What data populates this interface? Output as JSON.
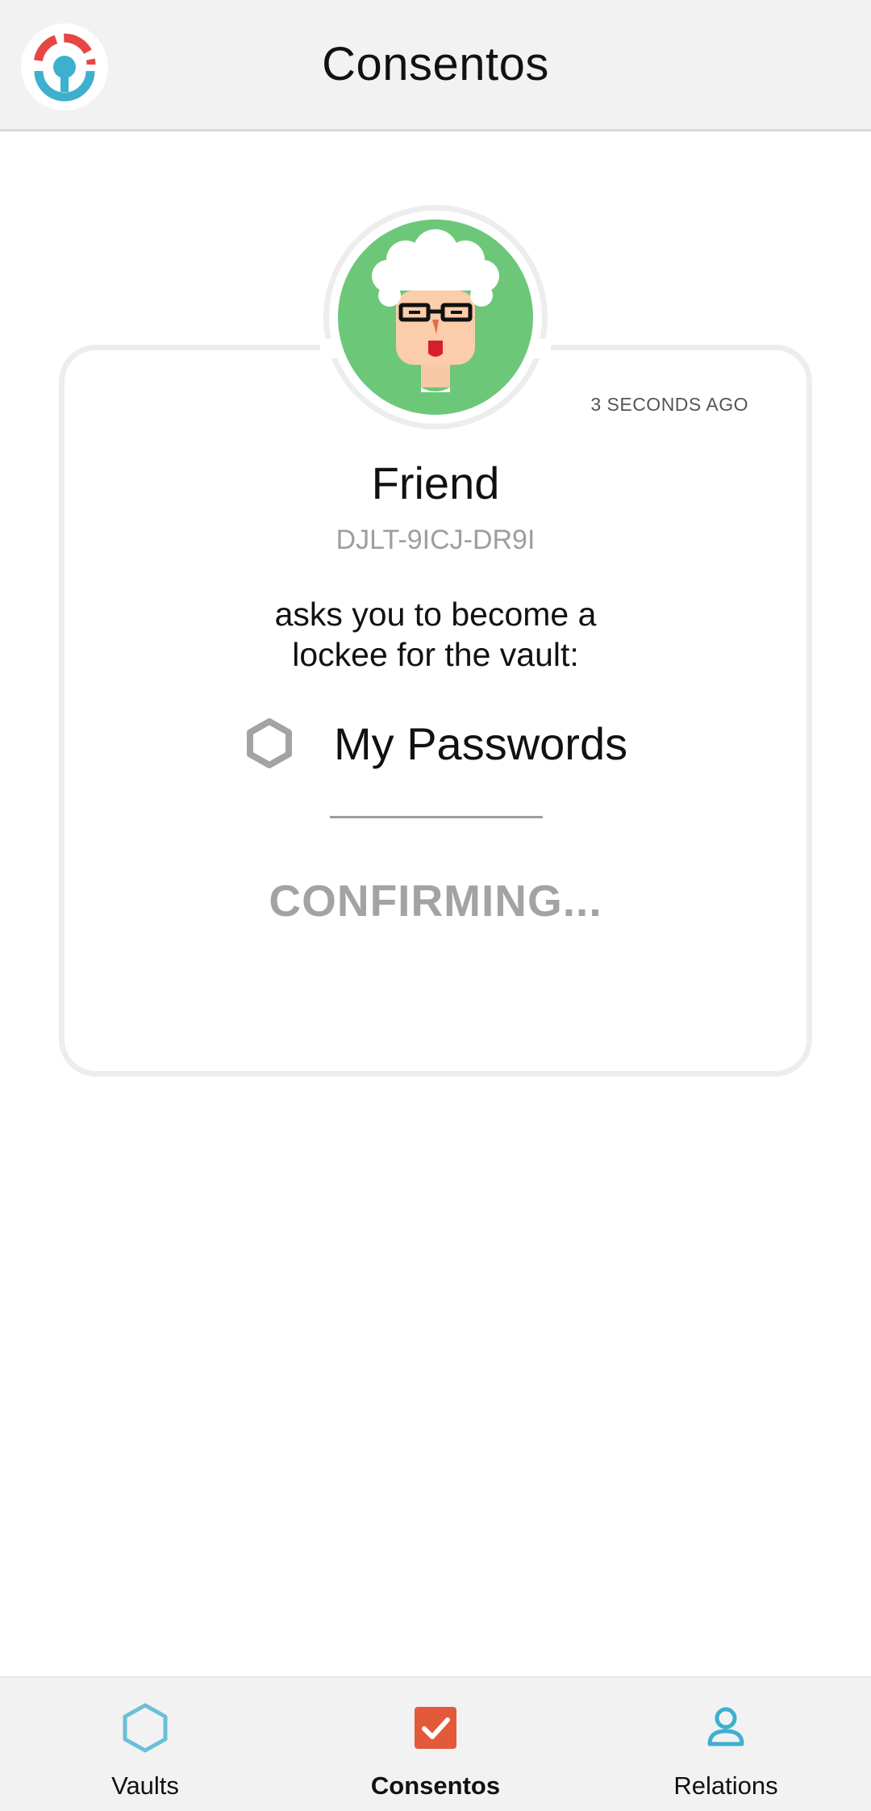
{
  "header": {
    "title": "Consentos",
    "logo_icon": "lifebuoy-logo-icon"
  },
  "request": {
    "timestamp": "3 SECONDS AGO",
    "requester_name": "Friend",
    "requester_code": "DJLT-9ICJ-DR9I",
    "message": "asks you to become a lockee for the vault:",
    "vault_name": "My Passwords",
    "vault_icon": "hexagon-icon",
    "status": "CONFIRMING..."
  },
  "bottom_nav": {
    "active": "Consentos",
    "items": [
      {
        "label": "Vaults",
        "icon": "hexagon-icon"
      },
      {
        "label": "Consentos",
        "icon": "checkbox-icon"
      },
      {
        "label": "Relations",
        "icon": "person-icon"
      }
    ]
  },
  "colors": {
    "accent_blue": "#3db0cf",
    "accent_red": "#e84545",
    "avatar_green": "#6cc878",
    "checkbox_orange": "#e35a3a",
    "muted_gray": "#a3a3a3"
  }
}
